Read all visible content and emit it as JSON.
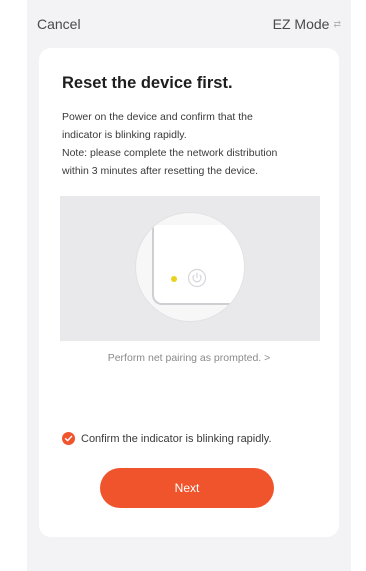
{
  "header": {
    "cancel_label": "Cancel",
    "mode_label": "EZ Mode"
  },
  "card": {
    "title": "Reset the device first.",
    "description_line1": "Power on the device and confirm that the",
    "description_line2": "indicator is blinking rapidly.",
    "description_line3": "Note: please complete the network distribution",
    "description_line4": "within 3 minutes after resetting the device.",
    "pairing_link": "Perform net pairing as prompted. >",
    "confirm_label": "Confirm the indicator is blinking rapidly.",
    "confirm_checked": true,
    "next_label": "Next"
  },
  "colors": {
    "accent": "#f0542d",
    "indicator_led": "#e8d21c"
  },
  "icons": {
    "mode_switch": "swap-arrows-icon",
    "power": "power-icon",
    "check": "check-circle-icon"
  }
}
